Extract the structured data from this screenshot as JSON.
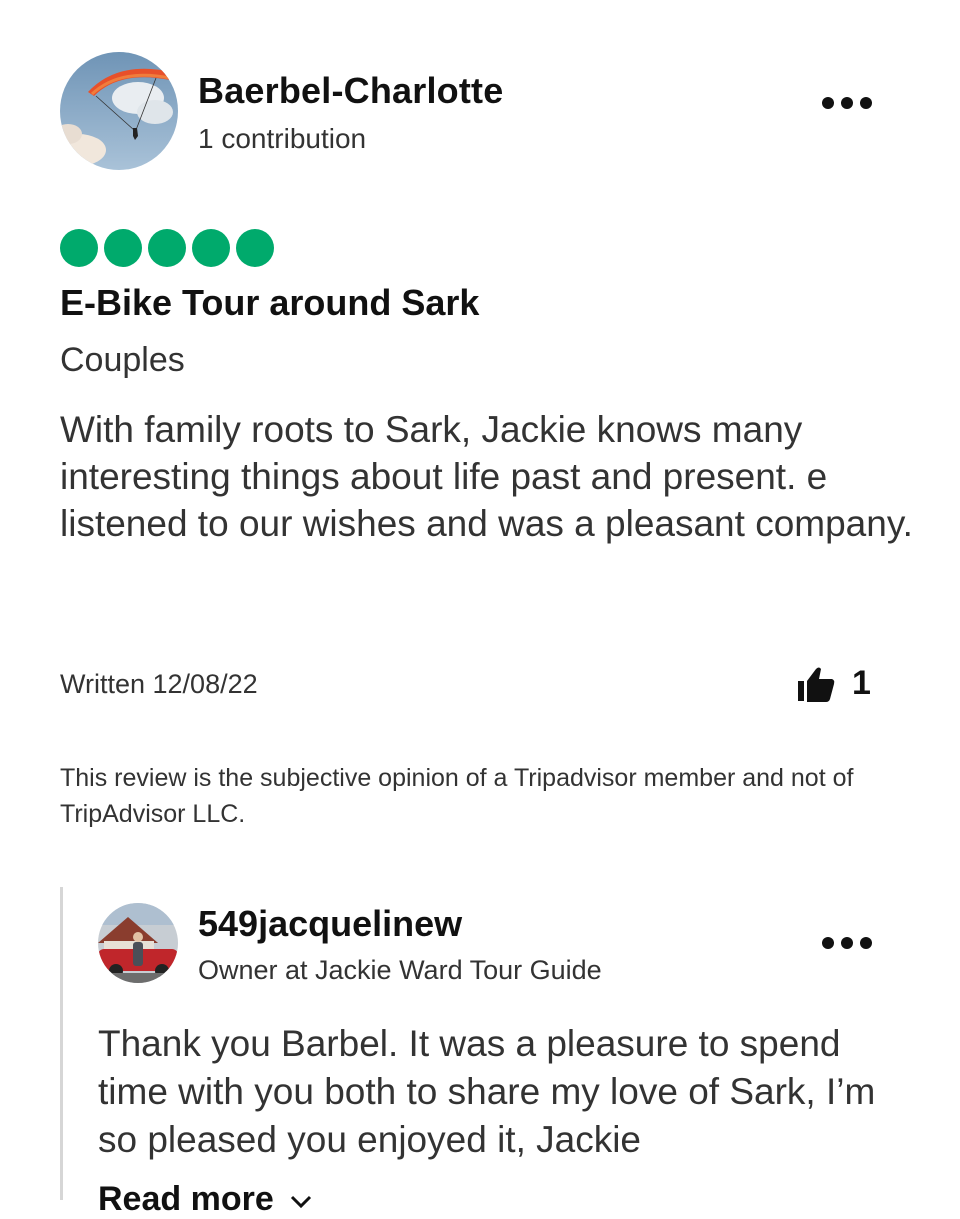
{
  "review": {
    "author": {
      "name": "Baerbel-Charlotte",
      "contributions": "1 contribution"
    },
    "rating": {
      "value": 5,
      "max": 5,
      "color": "#00aa6c"
    },
    "title": "E-Bike Tour around Sark",
    "trip_type": "Couples",
    "body": "With family roots to Sark, Jackie knows many interesting things about life past and present. e listened to our wishes and was a pleasant company.",
    "written": "Written 12/08/22",
    "helpful_count": "1",
    "disclaimer": "This review is the subjective opinion of a Tripadvisor member and not of TripAdvisor LLC."
  },
  "response": {
    "author": {
      "name": "549jacquelinew",
      "role": "Owner at Jackie Ward Tour Guide"
    },
    "body": "Thank you Barbel. It was a pleasure to spend time with you both to share my love of Sark, I’m so pleased you enjoyed it, Jackie",
    "read_more": "Read more"
  },
  "icons": {
    "more": "more-options-icon",
    "helpful": "thumbs-up-icon",
    "read_more": "chevron-down-icon"
  }
}
